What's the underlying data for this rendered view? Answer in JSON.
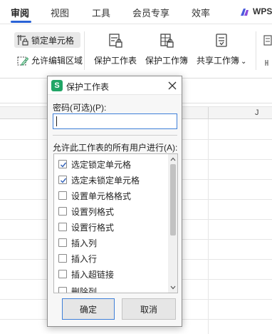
{
  "ribbon": {
    "tabs": [
      {
        "label": "审阅",
        "active": true
      },
      {
        "label": "视图"
      },
      {
        "label": "工具"
      },
      {
        "label": "会员专享"
      },
      {
        "label": "效率"
      }
    ],
    "wps_label": "WPS"
  },
  "toolbar": {
    "lock_cell": "锁定单元格",
    "allow_edit_range": "允许编辑区域",
    "protect_sheet": "保护工作表",
    "protect_workbook": "保护工作簿",
    "share_workbook": "共享工作簿",
    "dropdown_caret": "⌄"
  },
  "sheet": {
    "column_label": "J"
  },
  "dialog": {
    "app_icon": "S",
    "title": "保护工作表",
    "password_label": "密码(可选)(P):",
    "password_value": "",
    "allow_label": "允许此工作表的所有用户进行(A):",
    "permissions": [
      {
        "label": "选定锁定单元格",
        "checked": true
      },
      {
        "label": "选定未锁定单元格",
        "checked": true
      },
      {
        "label": "设置单元格格式",
        "checked": false
      },
      {
        "label": "设置列格式",
        "checked": false
      },
      {
        "label": "设置行格式",
        "checked": false
      },
      {
        "label": "插入列",
        "checked": false
      },
      {
        "label": "插入行",
        "checked": false
      },
      {
        "label": "插入超链接",
        "checked": false
      },
      {
        "label": "删除列",
        "checked": false
      }
    ],
    "ok_label": "确定",
    "cancel_label": "取消"
  },
  "colors": {
    "accent": "#2a63d6",
    "focus_border": "#3f7fd8",
    "app_green": "#21a566"
  }
}
